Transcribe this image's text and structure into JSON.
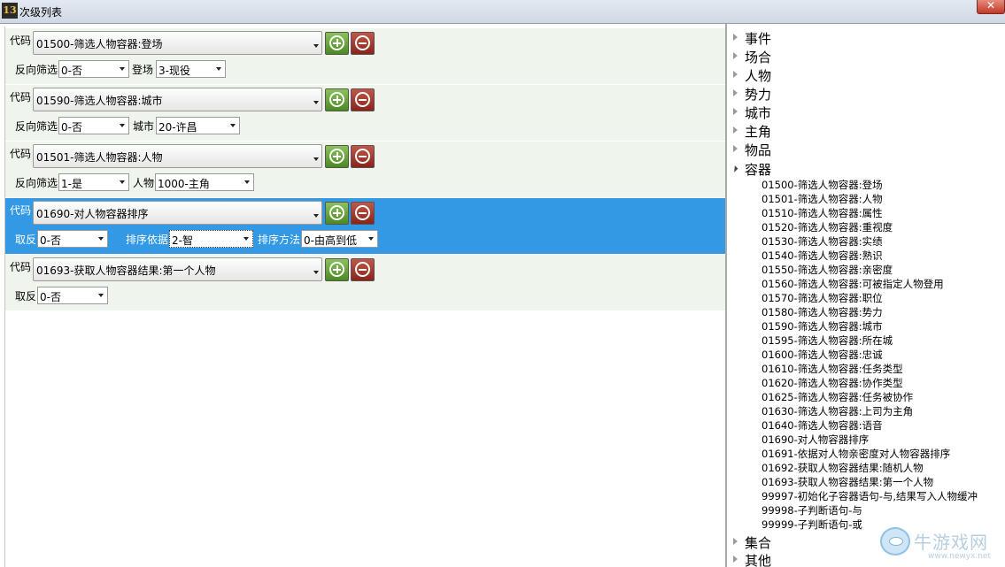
{
  "window": {
    "icon_text": "13",
    "title": "次级列表"
  },
  "rows": [
    {
      "code_label": "代码",
      "code_value": "01500-筛选人物容器:登场",
      "fields": [
        {
          "label": "反向筛选",
          "value": "0-否"
        },
        {
          "label": "登场",
          "value": "3-现役"
        }
      ]
    },
    {
      "code_label": "代码",
      "code_value": "01590-筛选人物容器:城市",
      "fields": [
        {
          "label": "反向筛选",
          "value": "0-否"
        },
        {
          "label": "城市",
          "value": "20-许昌"
        }
      ]
    },
    {
      "code_label": "代码",
      "code_value": "01501-筛选人物容器:人物",
      "fields": [
        {
          "label": "反向筛选",
          "value": "1-是"
        },
        {
          "label": "人物",
          "value": "1000-主角"
        }
      ]
    },
    {
      "code_label": "代码",
      "code_value": "01690-对人物容器排序",
      "selected": true,
      "fields": [
        {
          "label": "取反",
          "value": "0-否"
        },
        {
          "label": "排序依据",
          "value": "2-智"
        },
        {
          "label": "排序方法",
          "value": "0-由高到低"
        }
      ]
    },
    {
      "code_label": "代码",
      "code_value": "01693-获取人物容器结果:第一个人物",
      "fields": [
        {
          "label": "取反",
          "value": "0-否"
        }
      ]
    }
  ],
  "tree": {
    "categories_top": [
      "事件",
      "场合",
      "人物",
      "势力",
      "城市",
      "主角",
      "物品"
    ],
    "open_category": "容器",
    "items": [
      "01500-筛选人物容器:登场",
      "01501-筛选人物容器:人物",
      "01510-筛选人物容器:属性",
      "01520-筛选人物容器:重视度",
      "01530-筛选人物容器:实绩",
      "01540-筛选人物容器:熟识",
      "01550-筛选人物容器:亲密度",
      "01560-筛选人物容器:可被指定人物登用",
      "01570-筛选人物容器:职位",
      "01580-筛选人物容器:势力",
      "01590-筛选人物容器:城市",
      "01595-筛选人物容器:所在城",
      "01600-筛选人物容器:忠诚",
      "01610-筛选人物容器:任务类型",
      "01620-筛选人物容器:协作类型",
      "01625-筛选人物容器:任务被协作",
      "01630-筛选人物容器:上司为主角",
      "01640-筛选人物容器:语音",
      "01690-对人物容器排序",
      "01691-依据对人物亲密度对人物容器排序",
      "01692-获取人物容器结果:随机人物",
      "01693-获取人物容器结果:第一个人物",
      "99997-初始化子容器语句-与,结果写入人物缓冲",
      "99998-子判断语句-与",
      "99999-子判断语句-或"
    ],
    "categories_bottom": [
      "集合",
      "其他"
    ]
  },
  "watermark": {
    "name": "牛游戏网",
    "url": "www.newyx.net"
  },
  "colors": {
    "row_bg": "#eff5ec",
    "selected_bg": "#3399e5",
    "add_green": "#6aa63a",
    "del_red": "#a83a2c"
  }
}
